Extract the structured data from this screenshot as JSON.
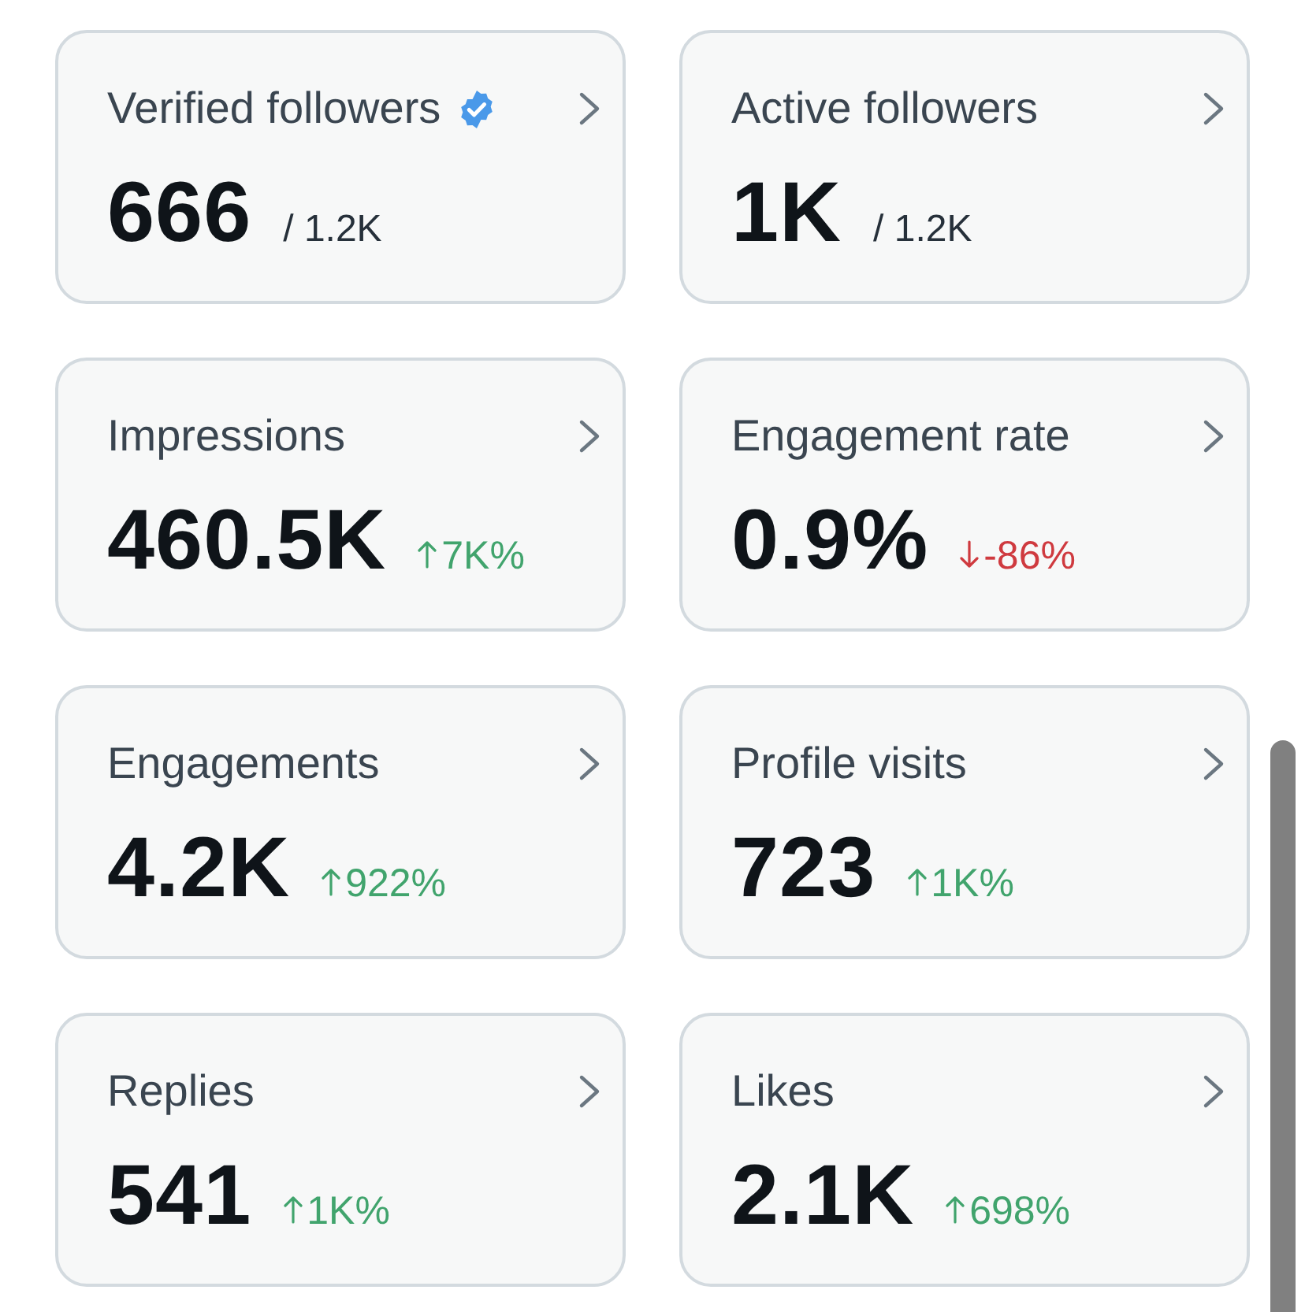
{
  "cards": [
    {
      "title": "Verified followers",
      "verified": true,
      "value": "666",
      "kind": "total",
      "total": "/ 1.2K"
    },
    {
      "title": "Active followers",
      "verified": false,
      "value": "1K",
      "kind": "total",
      "total": "/ 1.2K"
    },
    {
      "title": "Impressions",
      "verified": false,
      "value": "460.5K",
      "kind": "change",
      "rising": true,
      "change": "7K%"
    },
    {
      "title": "Engagement rate",
      "verified": false,
      "value": "0.9%",
      "kind": "change",
      "rising": false,
      "change": "-86%"
    },
    {
      "title": "Engagements",
      "verified": false,
      "value": "4.2K",
      "kind": "change",
      "rising": true,
      "change": "922%"
    },
    {
      "title": "Profile visits",
      "verified": false,
      "value": "723",
      "kind": "change",
      "rising": true,
      "change": "1K%"
    },
    {
      "title": "Replies",
      "verified": false,
      "value": "541",
      "kind": "change",
      "rising": true,
      "change": "1K%"
    },
    {
      "title": "Likes",
      "verified": false,
      "value": "2.1K",
      "kind": "change",
      "rising": true,
      "change": "698%"
    }
  ]
}
